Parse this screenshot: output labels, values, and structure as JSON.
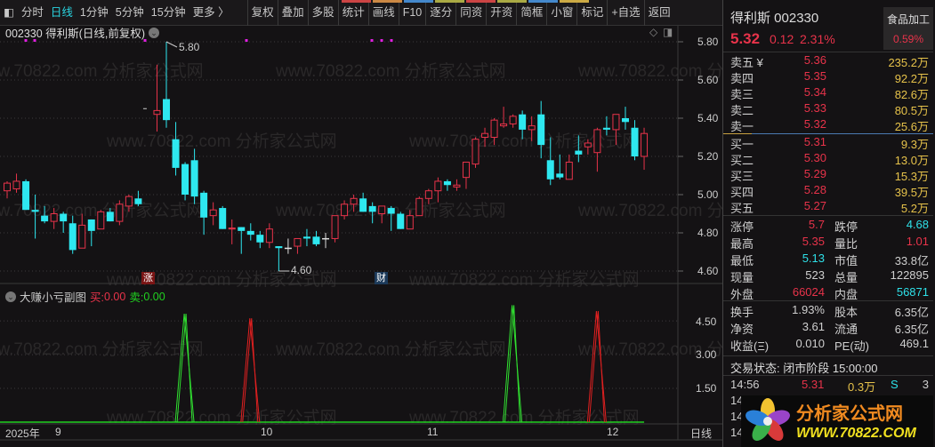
{
  "toolbar": {
    "items": [
      "分时",
      "日线",
      "1分钟",
      "5分钟",
      "15分钟",
      "更多 〉"
    ],
    "buttons": [
      "复权",
      "叠加",
      "多股",
      "统计",
      "画线",
      "F10",
      "逐分",
      "同资",
      "开资",
      "简框",
      "小窗",
      "标记",
      "+自选",
      "返回"
    ]
  },
  "chart": {
    "title": "002330 得利斯(日线,前复权)",
    "high_label": "5.80",
    "low_label": "4.60",
    "badge_zhang": "涨",
    "badge_cai": "财",
    "price_ticks": [
      "5.80",
      "5.60",
      "5.40",
      "5.20",
      "5.00",
      "4.80",
      "4.60"
    ],
    "watermark": "www.70822.com 分析家公式网"
  },
  "indicator": {
    "name": "大赚小亏副图",
    "buy_label": "买:",
    "buy_value": "0.00",
    "sell_label": "卖:",
    "sell_value": "0.00",
    "ticks": [
      "4.50",
      "3.00",
      "1.50"
    ]
  },
  "xaxis": {
    "year": "2025年",
    "months": [
      "9",
      "10",
      "11",
      "12"
    ],
    "period": "日线"
  },
  "chart_data": {
    "type": "candlestick",
    "ohlc": [
      [
        5.02,
        5.07,
        4.98,
        5.06
      ],
      [
        5.03,
        5.11,
        5.01,
        5.07
      ],
      [
        5.07,
        5.08,
        4.92,
        4.92
      ],
      [
        4.92,
        5.0,
        4.77,
        4.91
      ],
      [
        4.89,
        4.94,
        4.85,
        4.86
      ],
      [
        4.86,
        4.93,
        4.82,
        4.9
      ],
      [
        4.9,
        4.91,
        4.8,
        4.86
      ],
      [
        4.85,
        4.89,
        4.69,
        4.71
      ],
      [
        4.72,
        4.9,
        4.72,
        4.84
      ],
      [
        4.87,
        4.87,
        4.73,
        4.81
      ],
      [
        4.82,
        4.92,
        4.82,
        4.91
      ],
      [
        4.91,
        4.93,
        4.86,
        4.86
      ],
      [
        4.86,
        4.97,
        4.84,
        4.95
      ],
      [
        4.94,
        5.0,
        4.91,
        4.99
      ],
      [
        4.98,
        5.02,
        4.94,
        4.95
      ],
      [
        5.45,
        5.45,
        5.45,
        5.45
      ],
      [
        5.42,
        5.68,
        5.33,
        5.44
      ],
      [
        5.5,
        5.8,
        5.35,
        5.39
      ],
      [
        5.29,
        5.38,
        5.1,
        5.14
      ],
      [
        5.16,
        5.17,
        4.97,
        5.0
      ],
      [
        5.18,
        5.24,
        4.95,
        4.99
      ],
      [
        5.01,
        5.02,
        4.79,
        4.88
      ],
      [
        4.89,
        4.96,
        4.84,
        4.92
      ],
      [
        4.93,
        4.94,
        4.82,
        4.82
      ],
      [
        4.82,
        4.87,
        4.74,
        4.825
      ],
      [
        4.83,
        4.83,
        4.69,
        4.81
      ],
      [
        4.81,
        4.85,
        4.76,
        4.79
      ],
      [
        4.79,
        4.81,
        4.72,
        4.75
      ],
      [
        4.75,
        4.85,
        4.72,
        4.82
      ],
      [
        4.73,
        4.73,
        4.6,
        4.72
      ],
      [
        4.72,
        4.77,
        4.69,
        4.72
      ],
      [
        4.73,
        4.77,
        4.69,
        4.77
      ],
      [
        4.78,
        4.82,
        4.73,
        4.77
      ],
      [
        4.78,
        4.81,
        4.73,
        4.74
      ],
      [
        4.77,
        4.8,
        4.72,
        4.77
      ],
      [
        4.77,
        4.89,
        4.75,
        4.89
      ],
      [
        4.89,
        4.97,
        4.87,
        4.95
      ],
      [
        4.95,
        5.0,
        4.91,
        4.98
      ],
      [
        4.98,
        5.01,
        4.91,
        4.91
      ],
      [
        4.94,
        4.96,
        4.85,
        4.91
      ],
      [
        4.9,
        4.94,
        4.85,
        4.94
      ],
      [
        4.93,
        4.94,
        4.81,
        4.9
      ],
      [
        4.9,
        4.91,
        4.82,
        4.82
      ],
      [
        4.82,
        4.92,
        4.82,
        4.89
      ],
      [
        4.89,
        4.99,
        4.89,
        4.98
      ],
      [
        4.98,
        5.03,
        4.95,
        5.02
      ],
      [
        5.02,
        5.09,
        4.96,
        5.07
      ],
      [
        5.07,
        5.08,
        5.02,
        5.05
      ],
      [
        5.04,
        5.08,
        5.02,
        5.05
      ],
      [
        5.09,
        5.17,
        5.03,
        5.17
      ],
      [
        5.16,
        5.3,
        5.14,
        5.29
      ],
      [
        5.3,
        5.35,
        5.25,
        5.32
      ],
      [
        5.3,
        5.4,
        5.26,
        5.39
      ],
      [
        5.36,
        5.46,
        5.35,
        5.37
      ],
      [
        5.37,
        5.42,
        5.35,
        5.41
      ],
      [
        5.42,
        5.44,
        5.29,
        5.34
      ],
      [
        5.34,
        5.41,
        5.28,
        5.36
      ],
      [
        5.42,
        5.49,
        5.19,
        5.26
      ],
      [
        5.18,
        5.3,
        5.05,
        5.08
      ],
      [
        5.11,
        5.21,
        5.08,
        5.09
      ],
      [
        5.08,
        5.21,
        5.08,
        5.17
      ],
      [
        5.23,
        5.31,
        5.17,
        5.21
      ],
      [
        5.25,
        5.29,
        5.21,
        5.27
      ],
      [
        5.22,
        5.35,
        5.12,
        5.34
      ],
      [
        5.35,
        5.41,
        5.31,
        5.34
      ],
      [
        5.34,
        5.42,
        5.26,
        5.42
      ],
      [
        5.4,
        5.46,
        5.34,
        5.38
      ],
      [
        5.35,
        5.39,
        5.18,
        5.2
      ],
      [
        5.2,
        5.35,
        5.13,
        5.32
      ]
    ],
    "indicator_spikes": [
      {
        "index": 19,
        "value": 4.82,
        "color": "green"
      },
      {
        "index": 26,
        "value": 4.62,
        "color": "red"
      },
      {
        "index": 54,
        "value": 5.2,
        "color": "green"
      },
      {
        "index": 63,
        "value": 4.94,
        "color": "red"
      }
    ],
    "ylim": [
      4.6,
      5.8
    ],
    "indicator_ylim": [
      0,
      5.5
    ]
  },
  "quote": {
    "name": "得利斯 002330",
    "sector": "食品加工",
    "sector_change": "0.59%",
    "price": "5.32",
    "change": "0.12",
    "pct": "2.31%",
    "asks": [
      [
        "卖五 ¥",
        "5.36",
        "235.2万"
      ],
      [
        "卖四",
        "5.35",
        "92.2万"
      ],
      [
        "卖三",
        "5.34",
        "82.6万"
      ],
      [
        "卖二",
        "5.33",
        "80.5万"
      ],
      [
        "卖一",
        "5.32",
        "25.6万"
      ]
    ],
    "bids": [
      [
        "买一",
        "5.31",
        "9.3万"
      ],
      [
        "买二",
        "5.30",
        "13.0万"
      ],
      [
        "买三",
        "5.29",
        "15.3万"
      ],
      [
        "买四",
        "5.28",
        "39.5万"
      ],
      [
        "买五",
        "5.27",
        "5.2万"
      ]
    ],
    "stats1": [
      [
        "涨停",
        "5.7",
        "跌停",
        "4.68"
      ],
      [
        "最高",
        "5.35",
        "量比",
        "1.01"
      ],
      [
        "最低",
        "5.13",
        "市值",
        "33.8亿"
      ],
      [
        "现量",
        "523",
        "总量",
        "122895"
      ],
      [
        "外盘",
        "66024",
        "内盘",
        "56871"
      ]
    ],
    "stats2": [
      [
        "换手",
        "1.93%",
        "股本",
        "6.35亿"
      ],
      [
        "净资",
        "3.61",
        "流通",
        "6.35亿"
      ],
      [
        "收益(Ξ)",
        "0.010",
        "PE(动)",
        "469.1"
      ]
    ],
    "status": "交易状态: 闭市阶段 15:00:00",
    "ticks": [
      [
        "14:56",
        "5.31",
        "0.3万",
        "S",
        "3"
      ],
      [
        "14:5",
        "",
        "",
        "",
        ""
      ],
      [
        "14:",
        "",
        "",
        "",
        ""
      ],
      [
        "14:",
        "",
        "",
        "",
        ""
      ]
    ]
  },
  "logo": {
    "title": "分析家公式网",
    "url": "WWW.70822.COM"
  }
}
